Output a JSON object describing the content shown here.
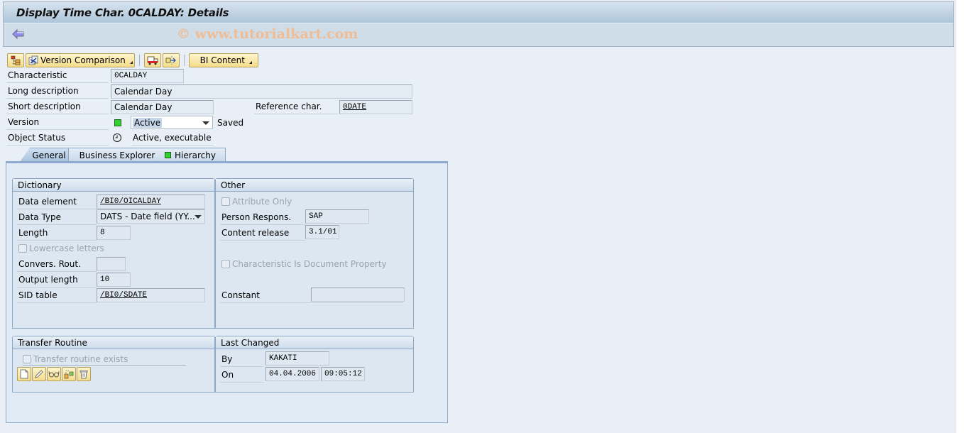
{
  "window": {
    "title": "Display Time Char. 0CALDAY: Details",
    "watermark": "© www.tutorialkart.com"
  },
  "nav": {
    "back_icon": "back-arrow-icon"
  },
  "toolbar": {
    "buttons": [
      {
        "icon": "hierarchy-tree-icon",
        "label": ""
      },
      {
        "icon": "version-comparison-icon",
        "label": "Version Comparison",
        "has_menu": true
      },
      {
        "icon": "transport-truck-icon",
        "label": ""
      },
      {
        "icon": "export-arrow-icon",
        "label": ""
      },
      {
        "icon": "",
        "label": "BI Content",
        "has_menu": true
      }
    ]
  },
  "header_fields": {
    "characteristic": {
      "label": "Characteristic",
      "value": "0CALDAY"
    },
    "long_description": {
      "label": "Long description",
      "value": "Calendar Day"
    },
    "short_description": {
      "label": "Short description",
      "value": "Calendar Day"
    },
    "reference_char": {
      "label": "Reference char.",
      "value": "0DATE"
    },
    "version": {
      "label": "Version",
      "selected": "Active",
      "status_text": "Saved",
      "status_color": "#2fd12f"
    },
    "object_status": {
      "label": "Object Status",
      "value": "Active, executable",
      "icon": "clock-icon"
    }
  },
  "tabs": [
    {
      "label": "General",
      "active": true
    },
    {
      "label": "Business Explorer",
      "active": false
    },
    {
      "label": "Hierarchy",
      "active": false,
      "status_color": "#2fd12f"
    }
  ],
  "general": {
    "dictionary": {
      "title": "Dictionary",
      "data_element": {
        "label": "Data element",
        "value": "/BI0/OICALDAY"
      },
      "data_type": {
        "label": "Data Type",
        "selected": "DATS - Date field (YY..."
      },
      "length": {
        "label": "Length",
        "value": "8"
      },
      "lowercase": {
        "label": "Lowercase letters",
        "checked": false
      },
      "convers_rout": {
        "label": "Convers. Rout.",
        "value": ""
      },
      "output_length": {
        "label": "Output length",
        "value": "10"
      },
      "sid_table": {
        "label": "SID table",
        "value": "/BI0/SDATE"
      }
    },
    "other": {
      "title": "Other",
      "attribute_only": {
        "label": "Attribute Only",
        "checked": false
      },
      "person_respons": {
        "label": "Person Respons.",
        "value": "SAP"
      },
      "content_release": {
        "label": "Content release",
        "value": "3.1/01"
      },
      "doc_property": {
        "label": "Characteristic Is Document Property",
        "checked": false
      },
      "constant": {
        "label": "Constant",
        "value": ""
      }
    },
    "transfer_routine": {
      "title": "Transfer Routine",
      "exists": {
        "label": "Transfer routine exists",
        "checked": false
      },
      "buttons": [
        "create-icon",
        "change-pencil-icon",
        "display-glasses-icon",
        "copy-icon",
        "delete-trash-icon"
      ]
    },
    "last_changed": {
      "title": "Last Changed",
      "by": {
        "label": "By",
        "value": "KAKATI"
      },
      "on": {
        "label": "On",
        "date": "04.04.2006",
        "time": "09:05:12"
      }
    }
  }
}
